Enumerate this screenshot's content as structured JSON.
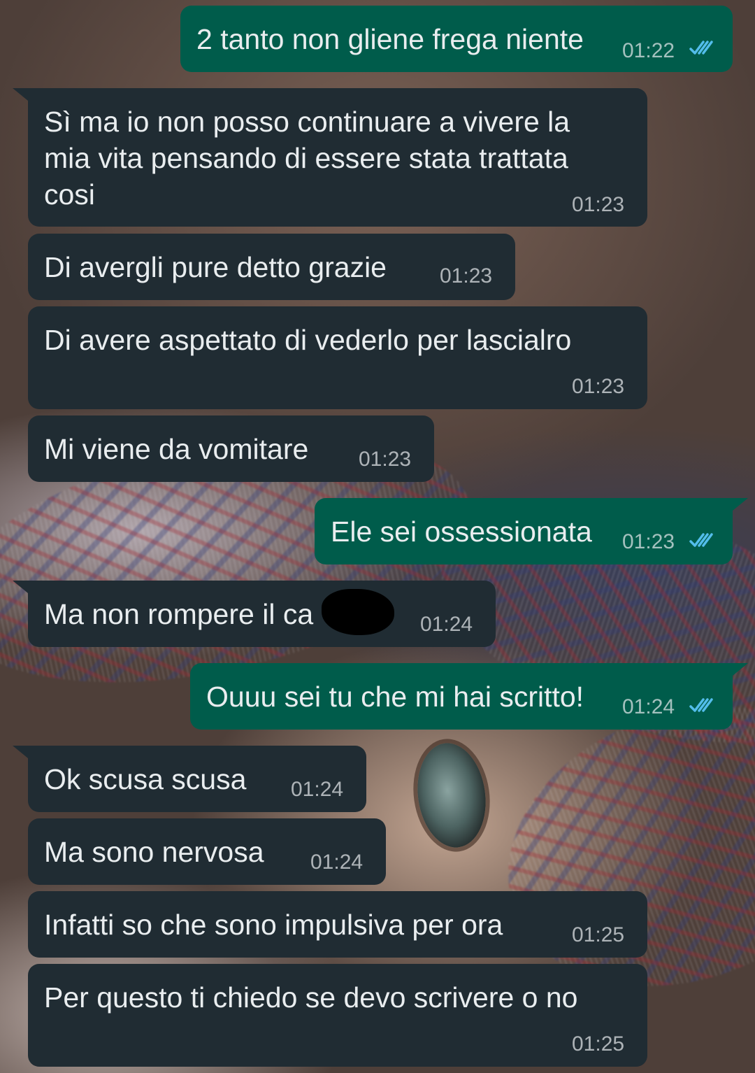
{
  "messages": [
    {
      "direction": "out",
      "text": "2 tanto non gliene frega niente",
      "time": "01:22",
      "status": "read"
    },
    {
      "direction": "in",
      "text": "Sì ma io non posso continuare a vivere la\nmia vita pensando di essere stata trattata\ncosi",
      "time": "01:23"
    },
    {
      "direction": "in",
      "text": "Di avergli pure detto grazie",
      "time": "01:23"
    },
    {
      "direction": "in",
      "text": "Di avere aspettato di vederlo per lascialro",
      "time": "01:23"
    },
    {
      "direction": "in",
      "text": "Mi viene da vomitare",
      "time": "01:23"
    },
    {
      "direction": "out",
      "text": "Ele sei ossessionata",
      "time": "01:23",
      "status": "read"
    },
    {
      "direction": "in",
      "text": "Ma non rompere il ca",
      "time": "01:24",
      "redacted": true
    },
    {
      "direction": "out",
      "text": "Ouuu sei tu che mi hai scritto!",
      "time": "01:24",
      "status": "read"
    },
    {
      "direction": "in",
      "text": "Ok scusa scusa",
      "time": "01:24"
    },
    {
      "direction": "in",
      "text": "Ma sono nervosa",
      "time": "01:24"
    },
    {
      "direction": "in",
      "text": "Infatti so che sono impulsiva per ora",
      "time": "01:25"
    },
    {
      "direction": "in",
      "text": "Per questo ti chiedo se devo scrivere o no",
      "time": "01:25"
    }
  ],
  "colors": {
    "incoming_bubble": "#202c33",
    "outgoing_bubble": "#005c4b",
    "read_ticks": "#53bdeb",
    "text": "#e9edef"
  },
  "icons": {
    "read_status": "double-check-icon"
  }
}
